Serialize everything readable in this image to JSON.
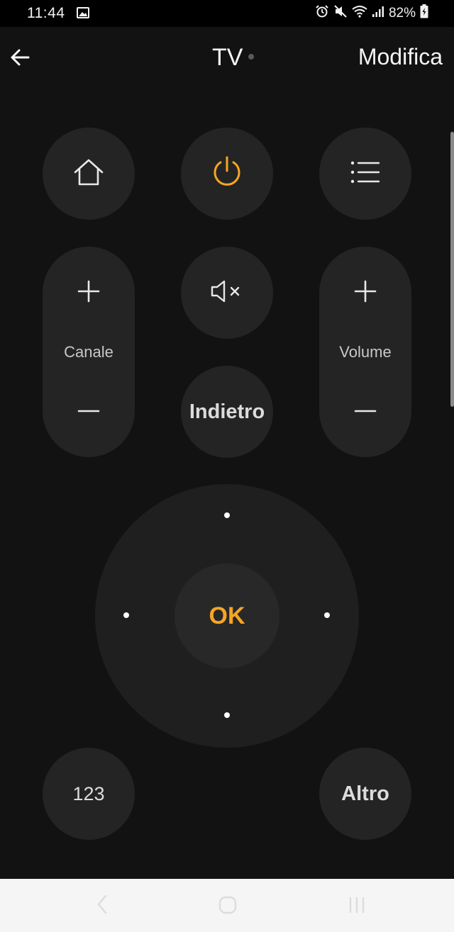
{
  "status_bar": {
    "time": "11:44",
    "battery_percent": "82%",
    "icons": [
      "image-icon",
      "alarm-icon",
      "mute-icon",
      "wifi-icon",
      "signal-icon",
      "battery-charging-icon"
    ]
  },
  "app_bar": {
    "title": "TV",
    "edit_label": "Modifica",
    "back_icon": "arrow-left-icon"
  },
  "remote": {
    "home_icon": "home-icon",
    "power_icon": "power-icon",
    "menu_icon": "list-menu-icon",
    "channel": {
      "label": "Canale",
      "up_icon": "plus-icon",
      "down_icon": "minus-icon"
    },
    "mute_icon": "mute-speaker-icon",
    "back_label": "Indietro",
    "volume": {
      "label": "Volume",
      "up_icon": "plus-icon",
      "down_icon": "minus-icon"
    },
    "ok_label": "OK",
    "numbers_label": "123",
    "more_label": "Altro"
  },
  "colors": {
    "background": "#121212",
    "button": "#242424",
    "accent": "#f5a623",
    "text": "#dcdcdc"
  },
  "system_nav": {
    "icons": [
      "back-nav-icon",
      "home-nav-icon",
      "recents-nav-icon"
    ]
  }
}
